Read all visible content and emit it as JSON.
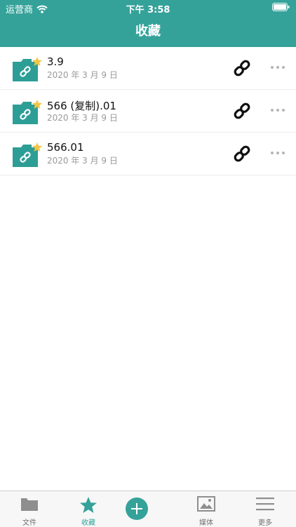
{
  "status_bar": {
    "carrier": "运营商",
    "time": "下午 3:58"
  },
  "header": {
    "title": "收藏"
  },
  "favorites": [
    {
      "name": "3.9",
      "date": "2020 年 3 月 9 日"
    },
    {
      "name": "566 (复制).01",
      "date": "2020 年 3 月 9 日"
    },
    {
      "name": "566.01",
      "date": "2020 年 3 月 9 日"
    }
  ],
  "tabbar": {
    "files_label": "文件",
    "favorites_label": "收藏",
    "media_label": "媒体",
    "more_label": "更多"
  },
  "colors": {
    "accent": "#35a29a",
    "star": "#f4c542"
  },
  "icons": {
    "status": [
      "wifi-icon",
      "battery-icon"
    ],
    "row": [
      "linked-folder-icon",
      "star-icon",
      "link-icon",
      "more-icon"
    ],
    "tabbar": [
      "folder-icon",
      "star-icon",
      "plus-icon",
      "image-icon",
      "menu-icon"
    ]
  }
}
